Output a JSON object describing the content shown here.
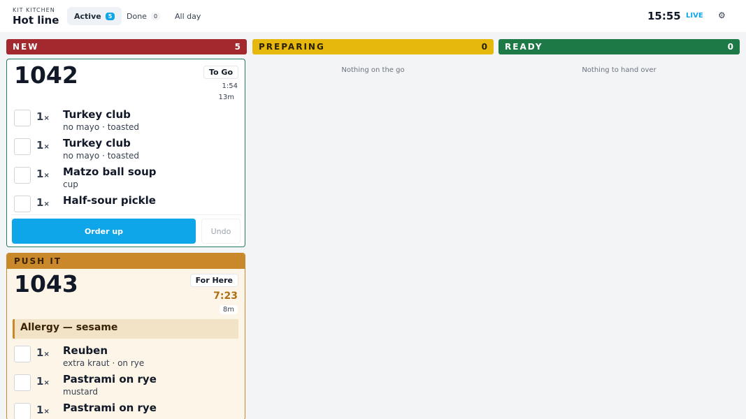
{
  "header": {
    "kicker": "KIT KITCHEN",
    "title": "Hot line",
    "tabs": [
      {
        "label": "Active",
        "count": "5"
      },
      {
        "label": "Done",
        "count": "0"
      },
      {
        "label": "All day"
      }
    ],
    "clock": "15:55",
    "live": "LIVE"
  },
  "columns": [
    {
      "label": "NEW",
      "count": "5",
      "color": "#a3292f"
    },
    {
      "label": "PREPARING",
      "count": "0",
      "color": "#e6b80e",
      "empty": "Nothing on the go"
    },
    {
      "label": "READY",
      "count": "0",
      "color": "#1d7a47",
      "empty": "Nothing to hand over"
    }
  ],
  "tickets": [
    {
      "number": "1042",
      "type": "To Go",
      "timer": "1:54",
      "age": "13m",
      "items": [
        {
          "qty": "1",
          "name": "Turkey club",
          "mods": "no mayo · toasted"
        },
        {
          "qty": "1",
          "name": "Turkey club",
          "mods": "no mayo · toasted"
        },
        {
          "qty": "1",
          "name": "Matzo ball soup",
          "mods": "cup"
        },
        {
          "qty": "1",
          "name": "Half-sour pickle",
          "mods": ""
        }
      ],
      "primary_action": "Order up",
      "secondary_action": "Undo"
    },
    {
      "flag": "PUSH IT",
      "number": "1043",
      "type": "For Here",
      "timer": "7:23",
      "age": "8m",
      "allergy": "Allergy — sesame",
      "items": [
        {
          "qty": "1",
          "name": "Reuben",
          "mods": "extra kraut · on rye"
        },
        {
          "qty": "1",
          "name": "Pastrami on rye",
          "mods": "mustard"
        },
        {
          "qty": "1",
          "name": "Pastrami on rye",
          "mods": ""
        }
      ]
    }
  ],
  "qty_suffix": "×",
  "icons": {
    "settings": "gear-icon"
  }
}
